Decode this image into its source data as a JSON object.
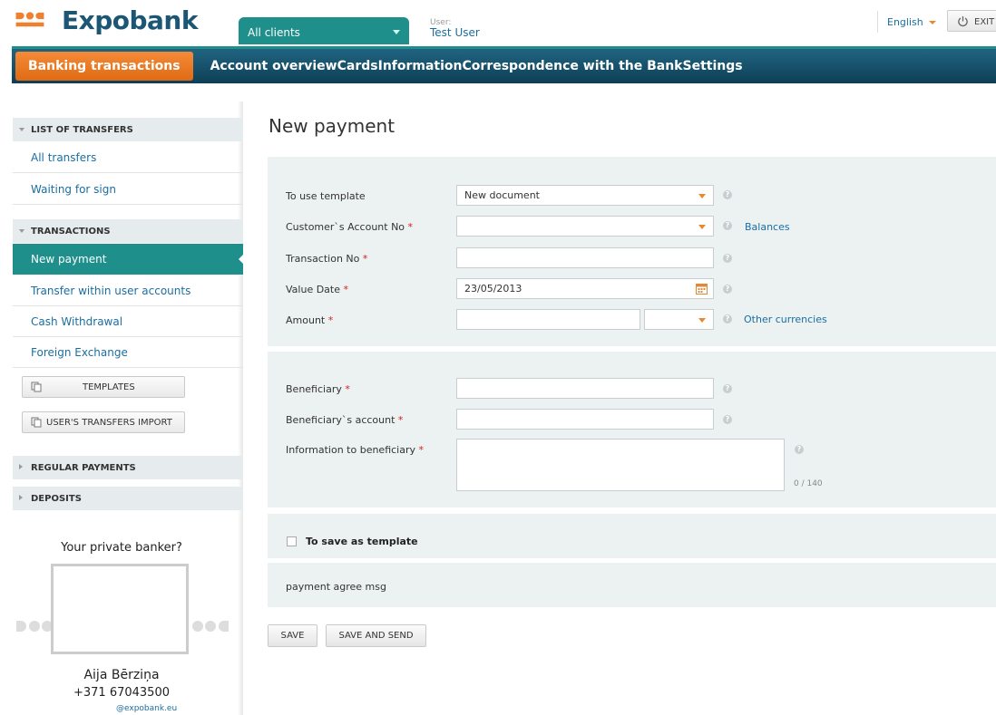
{
  "header": {
    "logo_text": "Expobank",
    "client_selector": "All clients",
    "user_caption": "User:",
    "user_name": "Test User",
    "language": "English",
    "exit_label": "EXIT"
  },
  "nav": {
    "items": [
      "Banking transactions",
      "Account overview",
      "Cards",
      "Information",
      "Correspondence with the Bank",
      "Settings"
    ],
    "active": "Banking transactions"
  },
  "sidebar": {
    "sections": {
      "transfers": "LIST OF TRANSFERS",
      "transactions": "TRANSACTIONS",
      "regular": "REGULAR PAYMENTS",
      "deposits": "DEPOSITS"
    },
    "transfer_links": [
      "All transfers",
      "Waiting for sign"
    ],
    "transaction_links": [
      "New payment",
      "Transfer within user accounts",
      "Cash Withdrawal",
      "Foreign Exchange"
    ],
    "active_link": "New payment",
    "templates_button": "TEMPLATES",
    "import_button": "USER'S TRANSFERS IMPORT"
  },
  "banker": {
    "title": "Your private banker?",
    "name": "Aija Bērziņa",
    "phone": "+371 67043500",
    "email": "@expobank.eu"
  },
  "form": {
    "title": "New payment",
    "template_label": "To use template",
    "template_value": "New document",
    "account_label": "Customer`s Account No",
    "balances_link": "Balances",
    "transaction_label": "Transaction No",
    "value_date_label": "Value Date",
    "value_date": "23/05/2013",
    "amount_label": "Amount",
    "other_currencies_link": "Other currencies",
    "beneficiary_label": "Beneficiary",
    "beneficiary_account_label": "Beneficiary`s account",
    "info_label": "Information to beneficiary",
    "char_counter": "0 / 140",
    "required_mark": "*",
    "help_glyph": "?",
    "save_template_label": "To save as template",
    "agree_message": "payment agree msg",
    "save_button": "SAVE",
    "save_send_button": "SAVE AND SEND"
  },
  "colors": {
    "brand_dark": "#1b5674",
    "accent_teal": "#1e8f8a",
    "accent_orange": "#f08030",
    "nav_bg": "#164f69",
    "panel_bg": "#ecf1f2",
    "link": "#1b6ea0",
    "required": "#d62020"
  }
}
